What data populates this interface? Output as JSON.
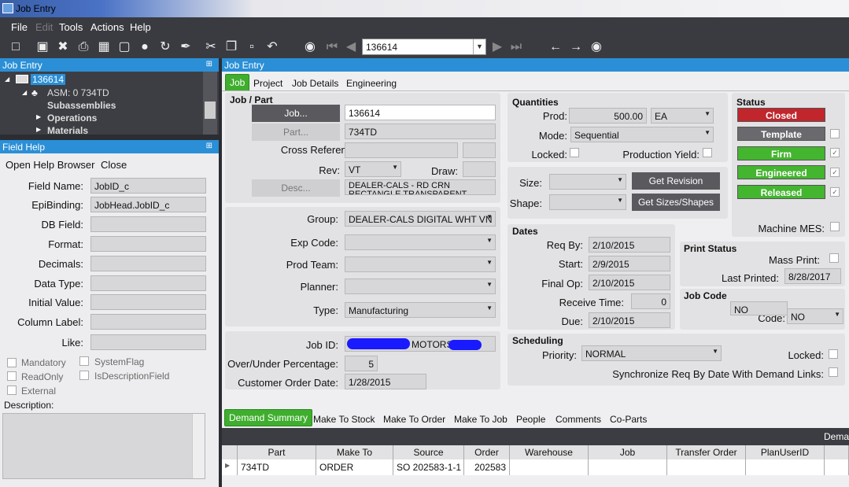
{
  "window": {
    "title": "Job Entry"
  },
  "menu": {
    "file": "File",
    "edit": "Edit",
    "tools": "Tools",
    "actions": "Actions",
    "help": "Help"
  },
  "nav": {
    "job_number": "136614"
  },
  "left_header": "Job Entry",
  "tree": {
    "root": "136614",
    "asm": "ASM: 0 734TD",
    "subassemblies": "Subassemblies",
    "operations": "Operations",
    "materials": "Materials"
  },
  "field_help": {
    "header": "Field Help",
    "open_browser": "Open Help Browser",
    "close": "Close",
    "labels": {
      "field_name": "Field Name:",
      "epibinding": "EpiBinding:",
      "db_field": "DB Field:",
      "format": "Format:",
      "decimals": "Decimals:",
      "data_type": "Data Type:",
      "initial_value": "Initial Value:",
      "column_label": "Column Label:",
      "like": "Like:",
      "description": "Description:"
    },
    "values": {
      "field_name": "JobID_c",
      "epibinding": "JobHead.JobID_c"
    },
    "checks": {
      "mandatory": "Mandatory",
      "readonly": "ReadOnly",
      "external": "External",
      "systemflag": "SystemFlag",
      "isdescription": "IsDescriptionField"
    }
  },
  "main_header": "Job Entry",
  "tabs": {
    "job": "Job",
    "project": "Project",
    "job_details": "Job Details",
    "engineering": "Engineering"
  },
  "job_part": {
    "title": "Job / Part",
    "job_btn": "Job...",
    "job_value": "136614",
    "part_btn": "Part...",
    "part_value": "734TD",
    "cross_ref": "Cross Reference:",
    "rev_label": "Rev:",
    "rev_value": "VT",
    "draw_label": "Draw:",
    "desc_btn": "Desc...",
    "desc_value": "DEALER-CALS - RD CRN RECTANGLE TRANSPARENT"
  },
  "classification": {
    "group_label": "Group:",
    "group_value": "DEALER-CALS DIGITAL WHT VN",
    "exp_label": "Exp Code:",
    "prodteam_label": "Prod Team:",
    "planner_label": "Planner:",
    "type_label": "Type:",
    "type_value": "Manufacturing"
  },
  "jobid": {
    "label": "Job ID:",
    "value": "MOTORS",
    "overunder_label": "Over/Under Percentage:",
    "overunder_value": "5",
    "custdate_label": "Customer Order Date:",
    "custdate_value": "1/28/2015"
  },
  "quantities": {
    "title": "Quantities",
    "prod_label": "Prod:",
    "prod_value": "500.00",
    "uom": "EA",
    "mode_label": "Mode:",
    "mode_value": "Sequential",
    "locked_label": "Locked:",
    "yield_label": "Production Yield:"
  },
  "size": {
    "size_label": "Size:",
    "shape_label": "Shape:",
    "get_revision": "Get Revision",
    "get_sizes": "Get Sizes/Shapes"
  },
  "dates": {
    "title": "Dates",
    "reqby_label": "Req By:",
    "reqby_value": "2/10/2015",
    "start_label": "Start:",
    "start_value": "2/9/2015",
    "finalop_label": "Final Op:",
    "finalop_value": "2/10/2015",
    "receive_label": "Receive Time:",
    "receive_value": "0",
    "due_label": "Due:",
    "due_value": "2/10/2015"
  },
  "status": {
    "title": "Status",
    "closed": "Closed",
    "template": "Template",
    "firm": "Firm",
    "engineered": "Engineered",
    "released": "Released",
    "machine_mes": "Machine MES:"
  },
  "print_status": {
    "title": "Print Status",
    "mass_print": "Mass Print:",
    "last_printed_label": "Last Printed:",
    "last_printed_value": "8/28/2017"
  },
  "job_code": {
    "title": "Job Code",
    "overlay": "NO",
    "code_label": "Code:",
    "code_value": "NO"
  },
  "scheduling": {
    "title": "Scheduling",
    "priority_label": "Priority:",
    "priority_value": "NORMAL",
    "locked_label": "Locked:",
    "sync_label": "Synchronize Req By Date With Demand Links:"
  },
  "bottom_tabs": {
    "demand": "Demand Summary",
    "stock": "Make To Stock",
    "order": "Make To Order",
    "job": "Make To Job",
    "people": "People",
    "comments": "Comments",
    "coparts": "Co-Parts"
  },
  "grid": {
    "corner_label": "Dema",
    "headers": {
      "part": "Part",
      "make_to": "Make To",
      "source": "Source",
      "order": "Order",
      "warehouse": "Warehouse",
      "job": "Job",
      "transfer": "Transfer Order",
      "planuser": "PlanUserID"
    },
    "row": {
      "part": "734TD",
      "make_to": "ORDER",
      "source": "SO 202583-1-1",
      "order": "202583"
    }
  },
  "colors": {
    "accent_blue": "#2a8fd6",
    "closed": "#c0262c",
    "template": "#6a6a6e",
    "green": "#44b52f"
  }
}
